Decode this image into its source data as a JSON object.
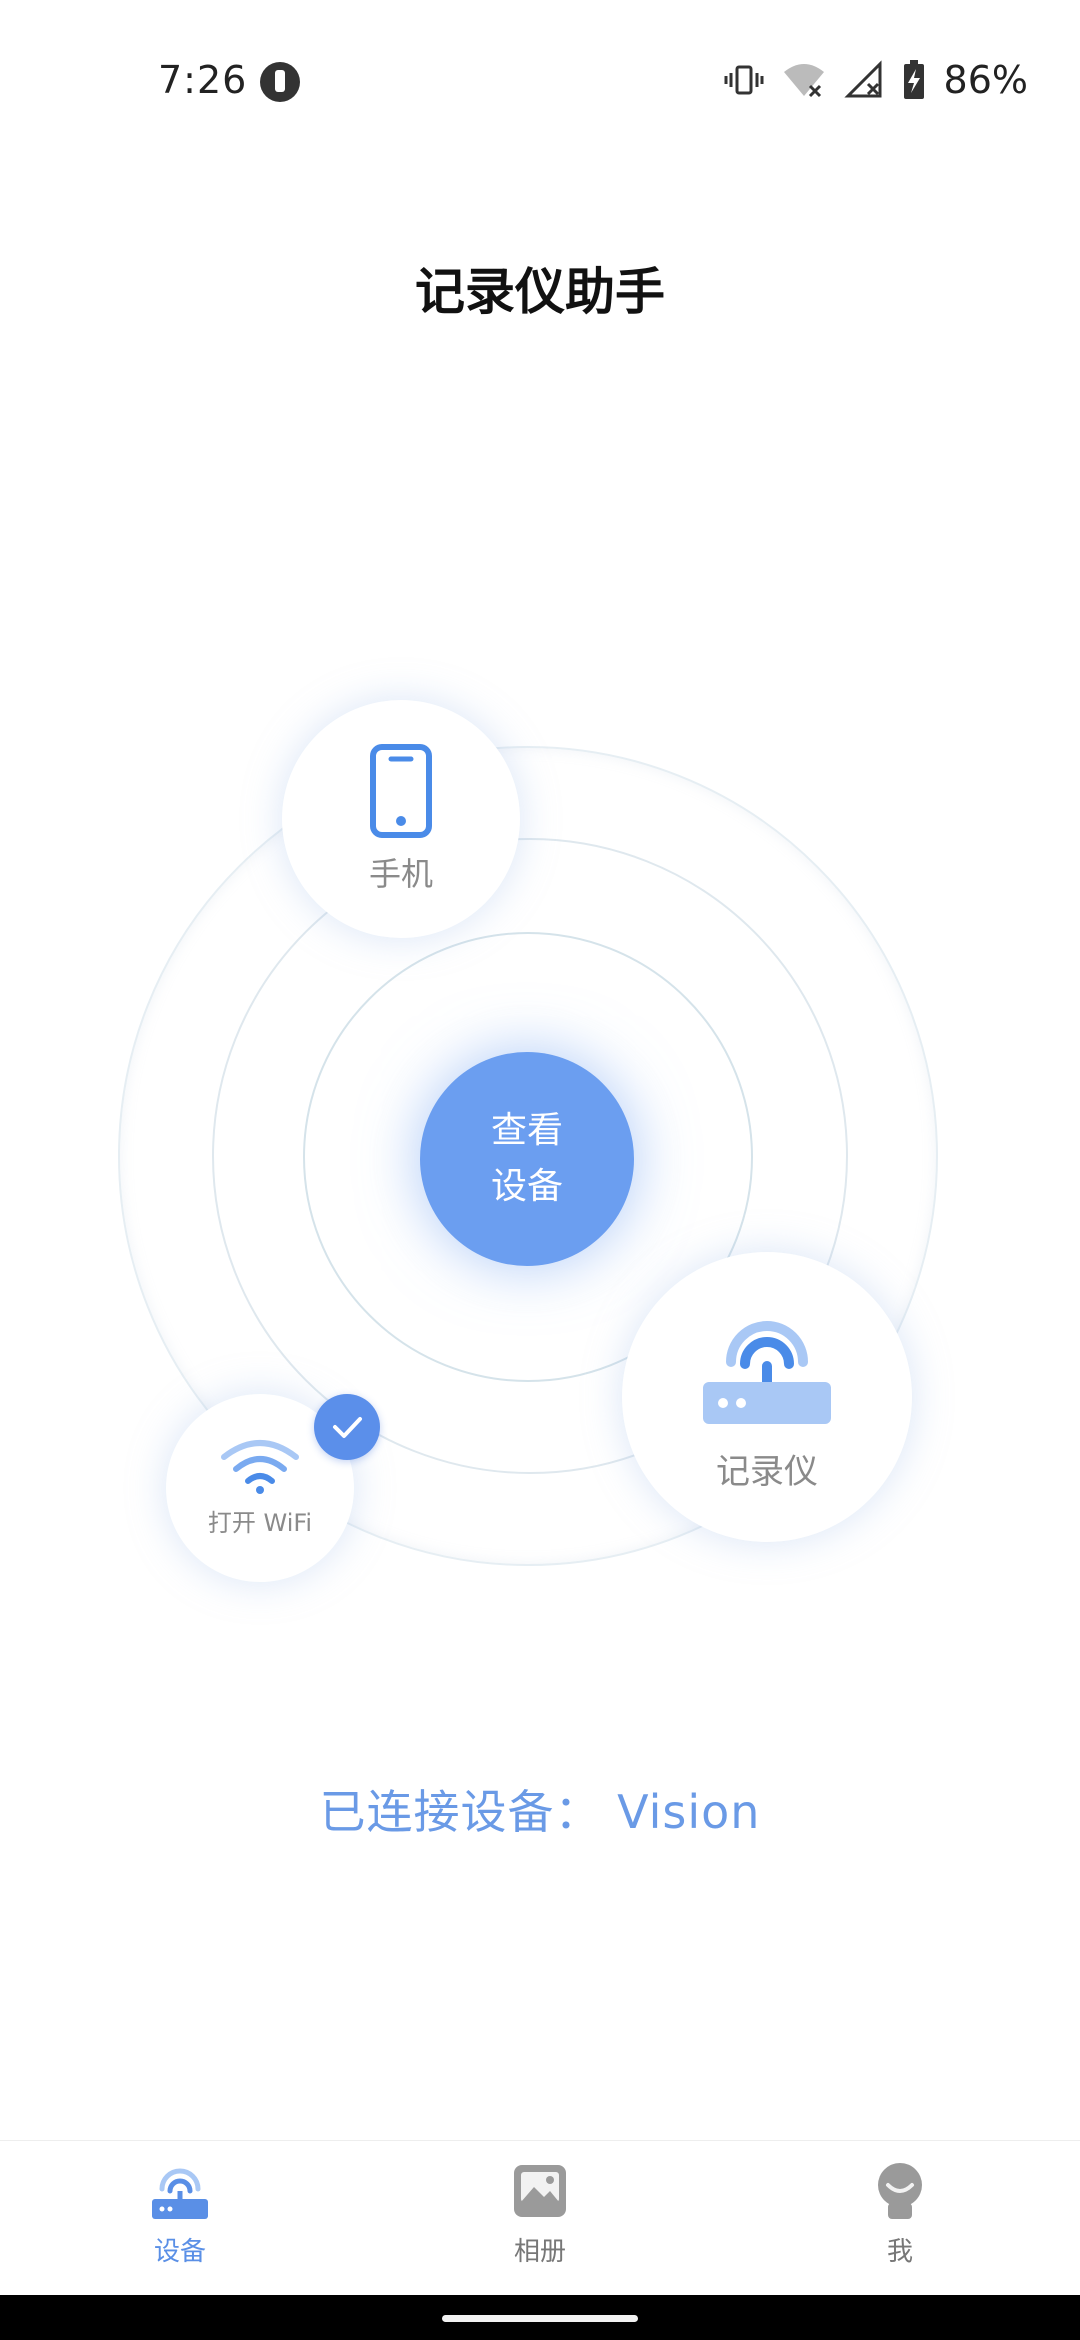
{
  "status_bar": {
    "time": "7:26",
    "battery_percent": "86%",
    "icons": [
      "vibrate-icon",
      "wifi-off-icon",
      "signal-off-icon",
      "battery-charging-icon"
    ]
  },
  "app": {
    "title": "记录仪助手"
  },
  "radar": {
    "center_button": {
      "line1": "查看",
      "line2": "设备"
    },
    "nodes": {
      "phone": {
        "label": "手机",
        "icon": "phone-icon"
      },
      "recorder": {
        "label": "记录仪",
        "icon": "router-icon"
      },
      "wifi": {
        "label": "打开 WiFi",
        "icon": "wifi-icon",
        "checked": true
      }
    }
  },
  "connection": {
    "text": "已连接设备： Vision"
  },
  "bottom_nav": {
    "items": [
      {
        "label": "设备",
        "icon": "router-icon",
        "active": true
      },
      {
        "label": "相册",
        "icon": "gallery-icon",
        "active": false
      },
      {
        "label": "我",
        "icon": "profile-icon",
        "active": false
      }
    ]
  },
  "colors": {
    "accent": "#6b9ef0",
    "accent_text": "#6a9ae6",
    "muted_text": "#8a8a8a"
  }
}
